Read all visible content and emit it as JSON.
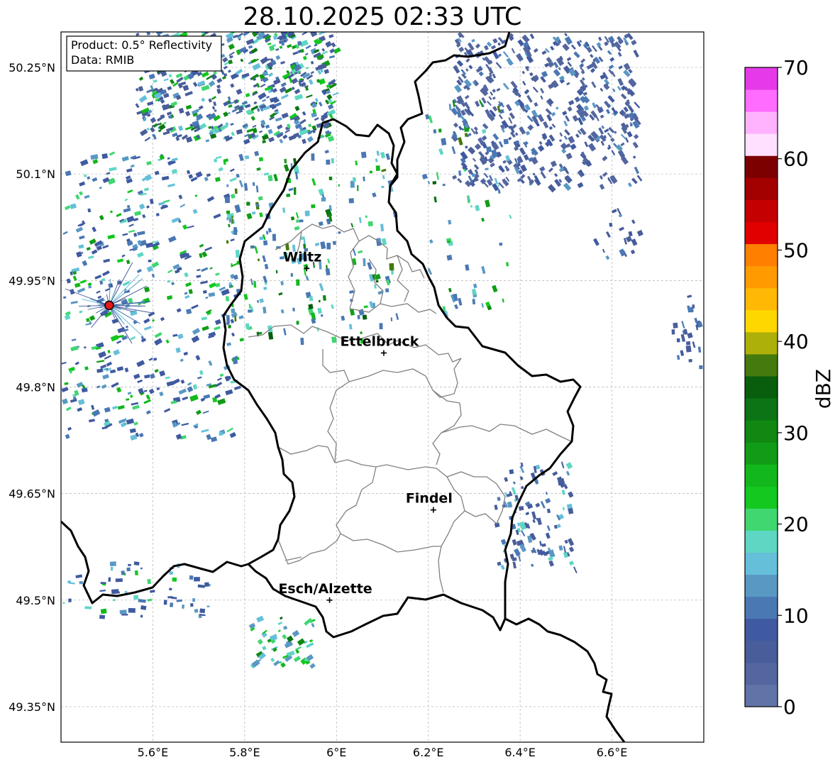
{
  "title": "28.10.2025 02:33 UTC",
  "info_box": {
    "product": "Product: 0.5° Reflectivity",
    "data": "Data: RMIB"
  },
  "map_extent": {
    "lon_min": 5.4,
    "lon_max": 6.8,
    "lat_min": 49.3,
    "lat_max": 50.3
  },
  "lat_ticks": [
    {
      "lat": 50.25,
      "label": "50.25°N"
    },
    {
      "lat": 50.1,
      "label": "50.1°N"
    },
    {
      "lat": 49.95,
      "label": "49.95°N"
    },
    {
      "lat": 49.8,
      "label": "49.8°N"
    },
    {
      "lat": 49.65,
      "label": "49.65°N"
    },
    {
      "lat": 49.5,
      "label": "49.5°N"
    },
    {
      "lat": 49.35,
      "label": "49.35°N"
    }
  ],
  "lon_ticks": [
    {
      "lon": 5.6,
      "label": "5.6°E"
    },
    {
      "lon": 5.8,
      "label": "5.8°E"
    },
    {
      "lon": 6.0,
      "label": "6°E"
    },
    {
      "lon": 6.2,
      "label": "6.2°E"
    },
    {
      "lon": 6.4,
      "label": "6.4°E"
    },
    {
      "lon": 6.6,
      "label": "6.6°E"
    }
  ],
  "cities": [
    {
      "name": "Wiltz",
      "lon": 5.935,
      "lat": 49.967
    },
    {
      "name": "Ettelbruck",
      "lon": 6.103,
      "lat": 49.848
    },
    {
      "name": "Findel",
      "lon": 6.211,
      "lat": 49.627
    },
    {
      "name": "Esch/Alzette",
      "lon": 5.985,
      "lat": 49.5
    }
  ],
  "radar_site": {
    "lon": 5.505,
    "lat": 49.915,
    "color": "#e31a1c"
  },
  "colorbar": {
    "label": "dBZ",
    "min": 0,
    "max": 70,
    "ticks": [
      "0",
      "10",
      "20",
      "30",
      "40",
      "50",
      "60",
      "70"
    ],
    "colors": [
      "#6174a8",
      "#53669f",
      "#495d9b",
      "#3f5aa0",
      "#4a78b3",
      "#5a98c4",
      "#65bfd9",
      "#5ed6c4",
      "#40d670",
      "#13c81f",
      "#12b81b",
      "#119c17",
      "#108812",
      "#0c7414",
      "#085e0c",
      "#457a0e",
      "#aeb00a",
      "#ffd700",
      "#ffb905",
      "#ff9b00",
      "#ff7f00",
      "#e10000",
      "#c50000",
      "#a30000",
      "#7d0000",
      "#ffe0ff",
      "#ffb3ff",
      "#ff6cff",
      "#e63ae8"
    ]
  },
  "colors": {
    "country_border": "#000000",
    "canton_border": "#808080",
    "grid": "#b0b0b0"
  }
}
